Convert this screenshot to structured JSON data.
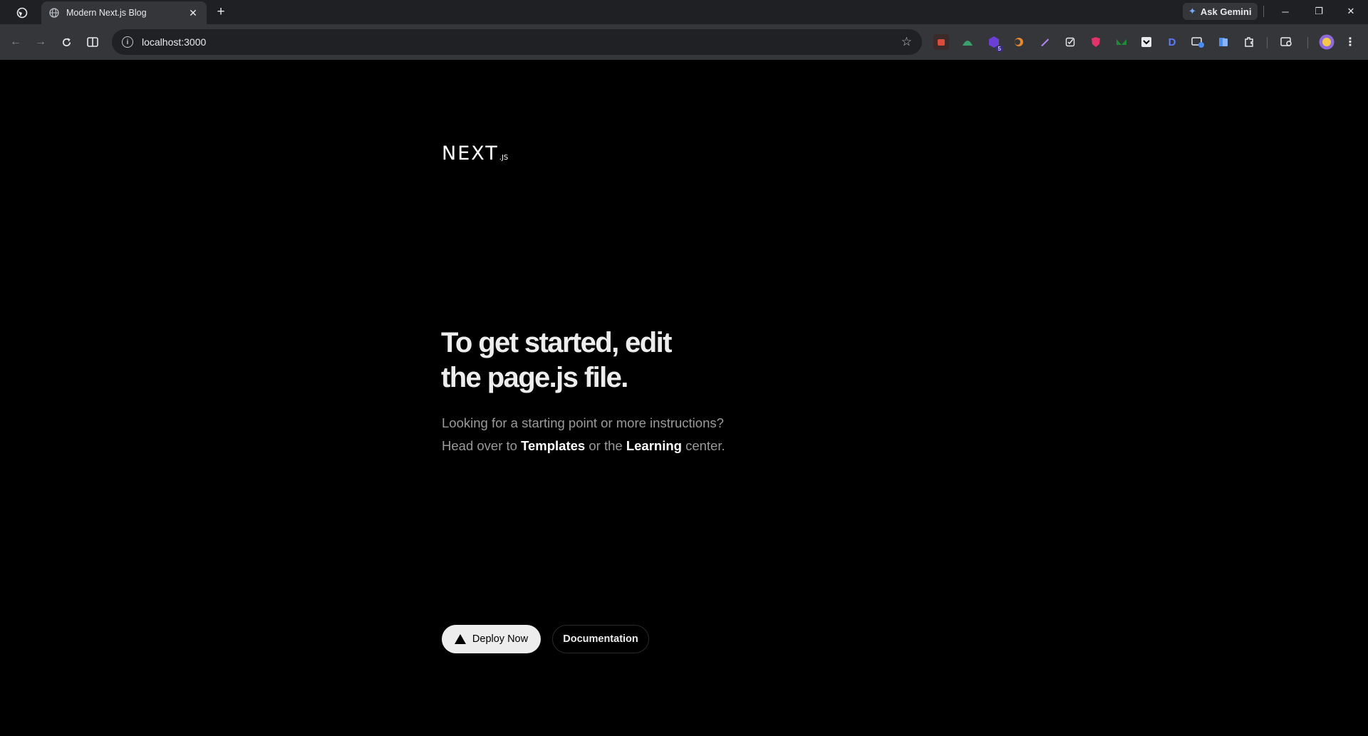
{
  "browser": {
    "tab_title": "Modern Next.js Blog",
    "tab_close": "✕",
    "new_tab": "+",
    "ask_gemini": "Ask Gemini",
    "url": "localhost:3000",
    "window_controls": {
      "minimize": "─",
      "restore": "❐",
      "close": "✕"
    },
    "extensions": [
      "extension-1",
      "extension-2",
      "extension-3",
      "extension-4",
      "extension-5",
      "extension-6",
      "extension-7",
      "extension-8",
      "extension-9",
      "extension-10",
      "extension-11",
      "extension-12",
      "extension-13"
    ],
    "extension_badge": "5"
  },
  "page": {
    "logo_main": "NEXT",
    "logo_sub": ".JS",
    "headline_line1": "To get started, edit",
    "headline_line2": "the page.js file.",
    "body_line1": "Looking for a starting point or more instructions?",
    "body_prefix": "Head over to ",
    "templates_link": "Templates",
    "body_middle": " or the ",
    "learning_link": "Learning",
    "body_suffix": " center.",
    "deploy_label": "Deploy Now",
    "docs_label": "Documentation"
  },
  "colors": {
    "background": "#000000",
    "headline": "#ededed",
    "body_text": "#9a9a9a",
    "deploy_bg": "#ededed"
  }
}
